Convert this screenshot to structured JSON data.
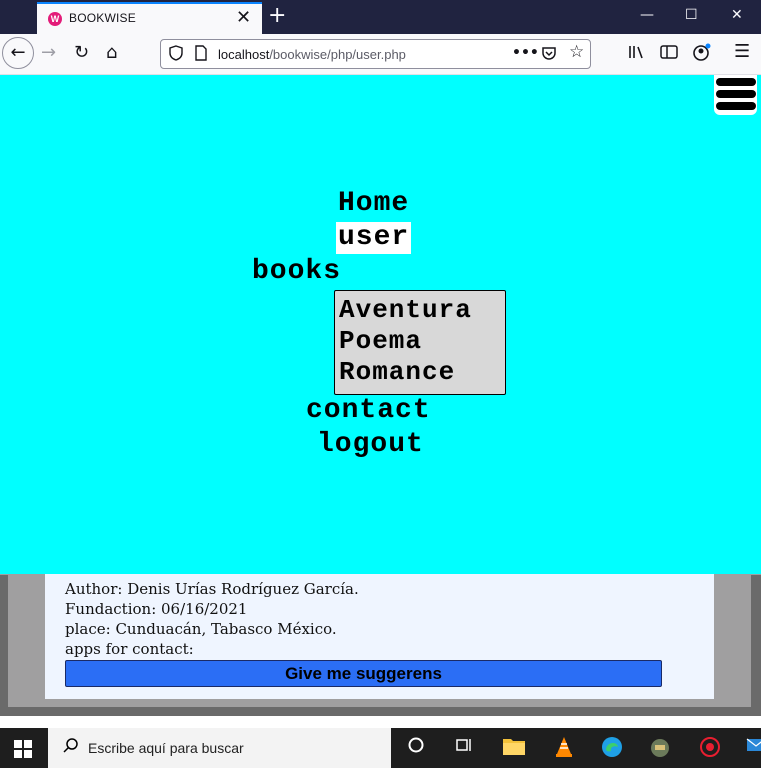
{
  "browser": {
    "tab_title": "BOOKWISE",
    "favicon_letter": "W",
    "close_tab_glyph": "✕",
    "new_tab_glyph": "+",
    "url_host": "localhost",
    "url_path": "/bookwise/php/user.php",
    "window_controls": {
      "minimize": "—",
      "maximize": "☐",
      "close": "✕"
    }
  },
  "menu": {
    "items": [
      {
        "label": "Home"
      },
      {
        "label": "user",
        "active": true
      },
      {
        "label": "books"
      },
      {
        "label": "contact"
      },
      {
        "label": "logout"
      }
    ],
    "books_dropdown": [
      "Aventura",
      "Poema",
      "Romance"
    ],
    "overlay_color": "#00ffff"
  },
  "info": {
    "author": "Author: Denis Urías Rodríguez García.",
    "fundaction": "Fundaction: 06/16/2021",
    "place": "place: Cunduacán, Tabasco México.",
    "apps": "apps for contact:",
    "suggest_button": "Give me suggerens"
  },
  "taskbar": {
    "search_placeholder": "Escribe aquí para buscar",
    "icons": [
      "task-view-icon",
      "timeline-icon",
      "file-explorer-icon",
      "vlc-icon",
      "edge-icon",
      "game-icon",
      "settings-app-icon",
      "mail-icon"
    ]
  }
}
